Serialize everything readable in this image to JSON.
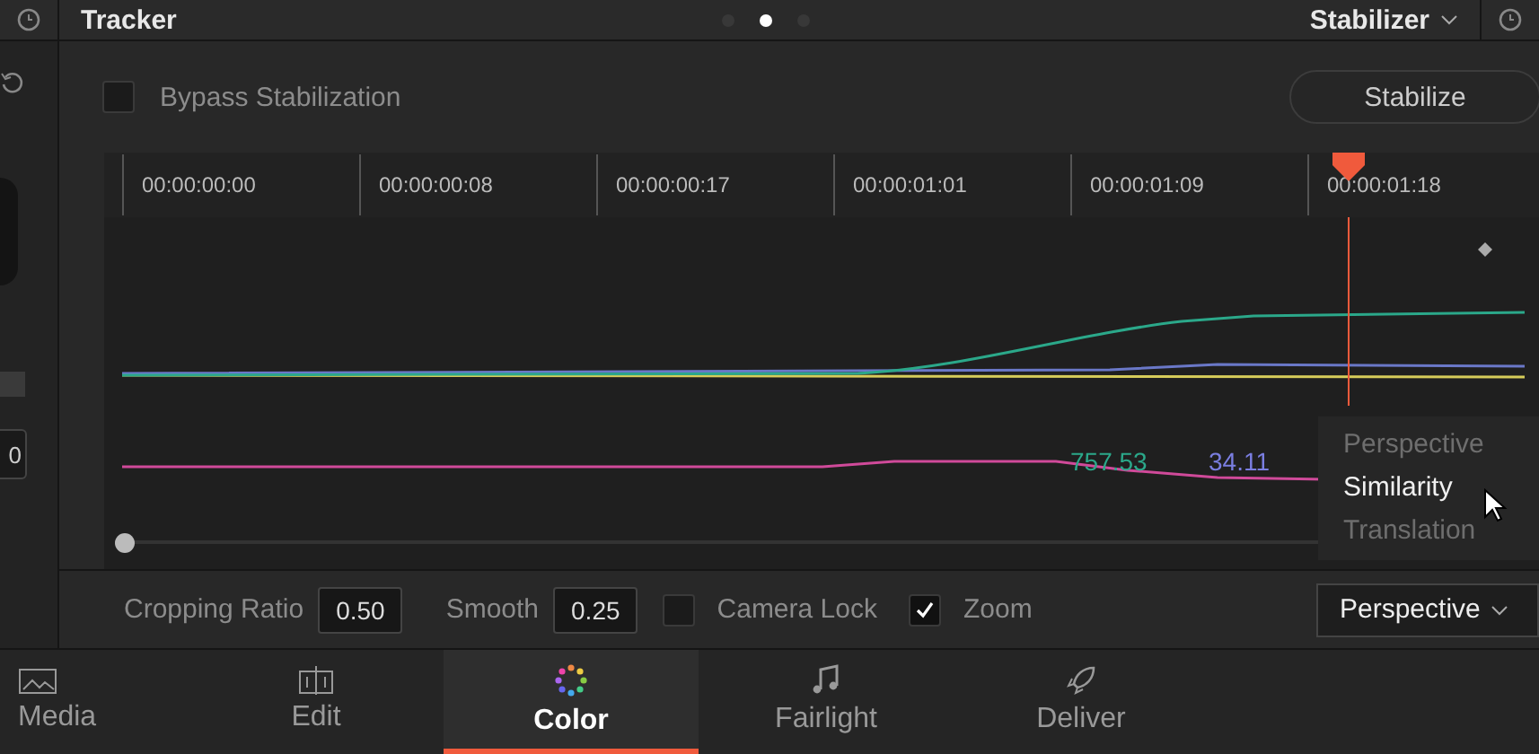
{
  "header": {
    "title": "Tracker",
    "page_dots": [
      {
        "selected": false
      },
      {
        "selected": true
      },
      {
        "selected": false
      }
    ],
    "mode": "Stabilizer"
  },
  "side_strip": {
    "field_value": "0"
  },
  "bypass": {
    "label": "Bypass Stabilization",
    "checked": false
  },
  "stabilize_button": "Stabilize",
  "ruler": [
    "00:00:00:00",
    "00:00:00:08",
    "00:00:00:17",
    "00:00:01:01",
    "00:00:01:09",
    "00:00:01:18"
  ],
  "graph": {
    "readouts": [
      {
        "text": "757.53",
        "color": "#2ba88a"
      },
      {
        "text": "34.11",
        "color": "#7a7ee0"
      }
    ],
    "menu": [
      {
        "label": "Perspective",
        "selected": false
      },
      {
        "label": "Similarity",
        "selected": true
      },
      {
        "label": "Translation",
        "selected": false
      }
    ]
  },
  "options": [
    {
      "kind": "field",
      "label": "Cropping Ratio",
      "value": "0.50"
    },
    {
      "kind": "field",
      "label": "Smooth",
      "value": "0.25"
    },
    {
      "kind": "check",
      "label": "Camera Lock",
      "checked": false
    },
    {
      "kind": "check",
      "label": "Zoom",
      "checked": true
    }
  ],
  "mode_select": "Perspective",
  "nav": [
    {
      "label": "Media",
      "selected": false
    },
    {
      "label": "Edit",
      "selected": false
    },
    {
      "label": "Color",
      "selected": true
    },
    {
      "label": "Fairlight",
      "selected": false
    },
    {
      "label": "Deliver",
      "selected": false
    }
  ]
}
